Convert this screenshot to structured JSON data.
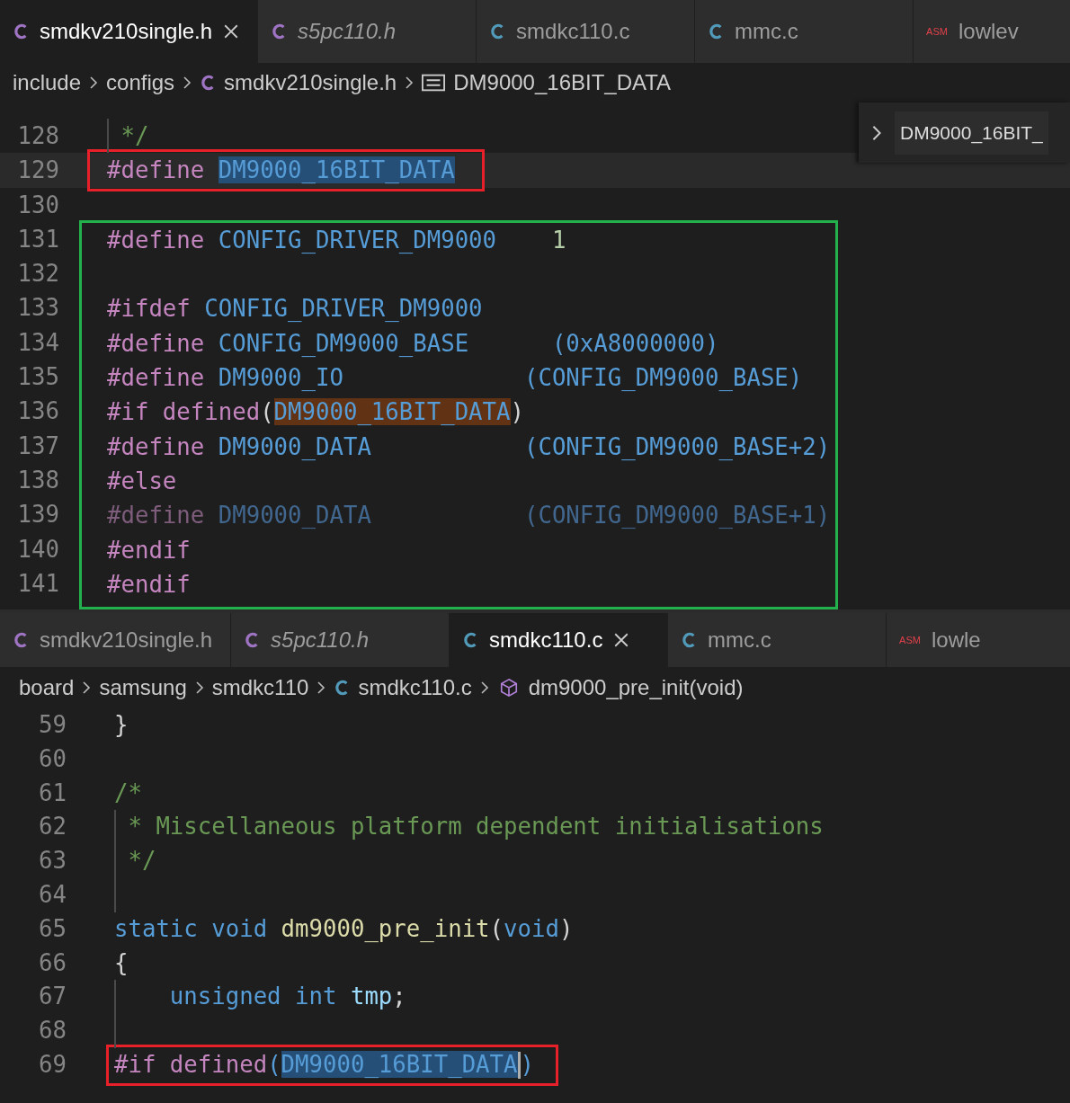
{
  "panes": [
    {
      "tabs": [
        {
          "label": "smdkv210single.h",
          "kind": "c-header",
          "selected": true,
          "preview": false
        },
        {
          "label": "s5pc110.h",
          "kind": "c-header",
          "selected": false,
          "preview": true
        },
        {
          "label": "smdkc110.c",
          "kind": "c-source",
          "selected": false,
          "preview": false
        },
        {
          "label": "mmc.c",
          "kind": "c-source",
          "selected": false,
          "preview": false
        },
        {
          "label": "lowlev",
          "kind": "asm",
          "selected": false,
          "preview": false
        }
      ],
      "asm_icon": "ASM",
      "breadcrumb": [
        {
          "label": "include",
          "kind": "folder"
        },
        {
          "label": "configs",
          "kind": "folder"
        },
        {
          "label": "smdkv210single.h",
          "kind": "c-header"
        },
        {
          "label": "DM9000_16BIT_DATA",
          "kind": "symbol-list"
        }
      ],
      "sticky": "DM9000_16BIT_",
      "blocks": [
        {
          "kind": "plain",
          "lines": [
            {
              "number": "128",
              "guide": true,
              "tokens": [
                {
                  "text": " */",
                  "kind": "comment"
                }
              ]
            }
          ]
        },
        {
          "kind": "current-red-frame",
          "lines": [
            {
              "number": "129",
              "guide": false,
              "tokens": [
                {
                  "text": "#define ",
                  "kind": "directive"
                },
                {
                  "text": "DM9000_16BIT_DATA",
                  "kind": "macro-selected"
                }
              ]
            }
          ]
        },
        {
          "kind": "plain",
          "lines": [
            {
              "number": "130",
              "guide": false
            }
          ]
        },
        {
          "kind": "green-frame",
          "lines": [
            {
              "number": "131",
              "guide": false,
              "tokens": [
                {
                  "text": "#define ",
                  "kind": "directive"
                },
                {
                  "text": "CONFIG_DRIVER_DM9000    ",
                  "kind": "macro"
                },
                {
                  "text": "1",
                  "kind": "number"
                }
              ]
            },
            {
              "number": "132",
              "guide": false
            },
            {
              "number": "133",
              "guide": false,
              "tokens": [
                {
                  "text": "#ifdef ",
                  "kind": "directive"
                },
                {
                  "text": "CONFIG_DRIVER_DM9000",
                  "kind": "macro"
                }
              ]
            },
            {
              "number": "134",
              "guide": false,
              "tokens": [
                {
                  "text": "#define ",
                  "kind": "directive"
                },
                {
                  "text": "CONFIG_DM9000_BASE      (0xA8000000)",
                  "kind": "macro"
                }
              ]
            },
            {
              "number": "135",
              "guide": false,
              "tokens": [
                {
                  "text": "#define ",
                  "kind": "directive"
                },
                {
                  "text": "DM9000_IO             (CONFIG_DM9000_BASE)",
                  "kind": "macro"
                }
              ]
            },
            {
              "number": "136",
              "guide": false,
              "tokens": [
                {
                  "text": "#if defined",
                  "kind": "directive"
                },
                {
                  "text": "(",
                  "kind": "punct"
                },
                {
                  "text": "DM9000_16BIT_DATA",
                  "kind": "macro-match"
                },
                {
                  "text": ")",
                  "kind": "punct"
                }
              ]
            },
            {
              "number": "137",
              "guide": false,
              "tokens": [
                {
                  "text": "#define ",
                  "kind": "directive"
                },
                {
                  "text": "DM9000_DATA           (CONFIG_DM9000_BASE+2)",
                  "kind": "macro"
                }
              ]
            },
            {
              "number": "138",
              "guide": false,
              "tokens": [
                {
                  "text": "#else",
                  "kind": "directive"
                }
              ]
            },
            {
              "number": "139",
              "guide": false,
              "tokens": [
                {
                  "text": "#define ",
                  "kind": "inactive-directive"
                },
                {
                  "text": "DM9000_DATA           (CONFIG_DM9000_BASE+1)",
                  "kind": "inactive"
                }
              ]
            },
            {
              "number": "140",
              "guide": false,
              "tokens": [
                {
                  "text": "#endif",
                  "kind": "directive"
                }
              ]
            },
            {
              "number": "141",
              "guide": false,
              "tokens": [
                {
                  "text": "#endif",
                  "kind": "directive"
                }
              ]
            }
          ]
        }
      ]
    },
    {
      "tabs": [
        {
          "label": "smdkv210single.h",
          "kind": "c-header",
          "selected": false,
          "preview": false
        },
        {
          "label": "s5pc110.h",
          "kind": "c-header",
          "selected": false,
          "preview": true
        },
        {
          "label": "smdkc110.c",
          "kind": "c-source",
          "selected": true,
          "preview": false
        },
        {
          "label": "mmc.c",
          "kind": "c-source",
          "selected": false,
          "preview": false
        },
        {
          "label": "lowle",
          "kind": "asm",
          "selected": false,
          "preview": false
        }
      ],
      "asm_icon": "ASM",
      "breadcrumb": [
        {
          "label": "board",
          "kind": "folder"
        },
        {
          "label": "samsung",
          "kind": "folder"
        },
        {
          "label": "smdkc110",
          "kind": "folder"
        },
        {
          "label": "smdkc110.c",
          "kind": "c-source"
        },
        {
          "label": "dm9000_pre_init(void)",
          "kind": "method"
        }
      ],
      "blocks": [
        {
          "kind": "plain",
          "lines": [
            {
              "number": "59",
              "guide": false,
              "tokens": [
                {
                  "text": "}",
                  "kind": "punct"
                }
              ]
            },
            {
              "number": "60",
              "guide": false
            },
            {
              "number": "61",
              "guide": false,
              "tokens": [
                {
                  "text": "/*",
                  "kind": "comment"
                }
              ]
            },
            {
              "number": "62",
              "guide": true,
              "tokens": [
                {
                  "text": " * Miscellaneous platform dependent initialisations",
                  "kind": "comment"
                }
              ]
            },
            {
              "number": "63",
              "guide": true,
              "tokens": [
                {
                  "text": " */",
                  "kind": "comment"
                }
              ]
            },
            {
              "number": "64",
              "guide": true
            },
            {
              "number": "65",
              "guide": false,
              "tokens": [
                {
                  "text": "static void ",
                  "kind": "keyword"
                },
                {
                  "text": "dm9000_pre_init",
                  "kind": "function"
                },
                {
                  "text": "(",
                  "kind": "punct"
                },
                {
                  "text": "void",
                  "kind": "keyword"
                },
                {
                  "text": ")",
                  "kind": "punct"
                }
              ]
            },
            {
              "number": "66",
              "guide": false,
              "tokens": [
                {
                  "text": "{",
                  "kind": "punct"
                }
              ]
            },
            {
              "number": "67",
              "guide": true,
              "tokens": [
                {
                  "text": "    unsigned int ",
                  "kind": "keyword"
                },
                {
                  "text": "tmp",
                  "kind": "variable"
                },
                {
                  "text": ";",
                  "kind": "punct"
                }
              ]
            },
            {
              "number": "68",
              "guide": true
            }
          ]
        },
        {
          "kind": "red-frame",
          "lines": [
            {
              "number": "69",
              "guide": false,
              "tokens": [
                {
                  "text": "#if defined",
                  "kind": "directive"
                },
                {
                  "text": "(",
                  "kind": "paren"
                },
                {
                  "text": "DM9000_16BIT_DATA",
                  "kind": "macro-selected",
                  "caret": true
                },
                {
                  "text": ")",
                  "kind": "paren"
                }
              ]
            }
          ]
        }
      ]
    }
  ]
}
